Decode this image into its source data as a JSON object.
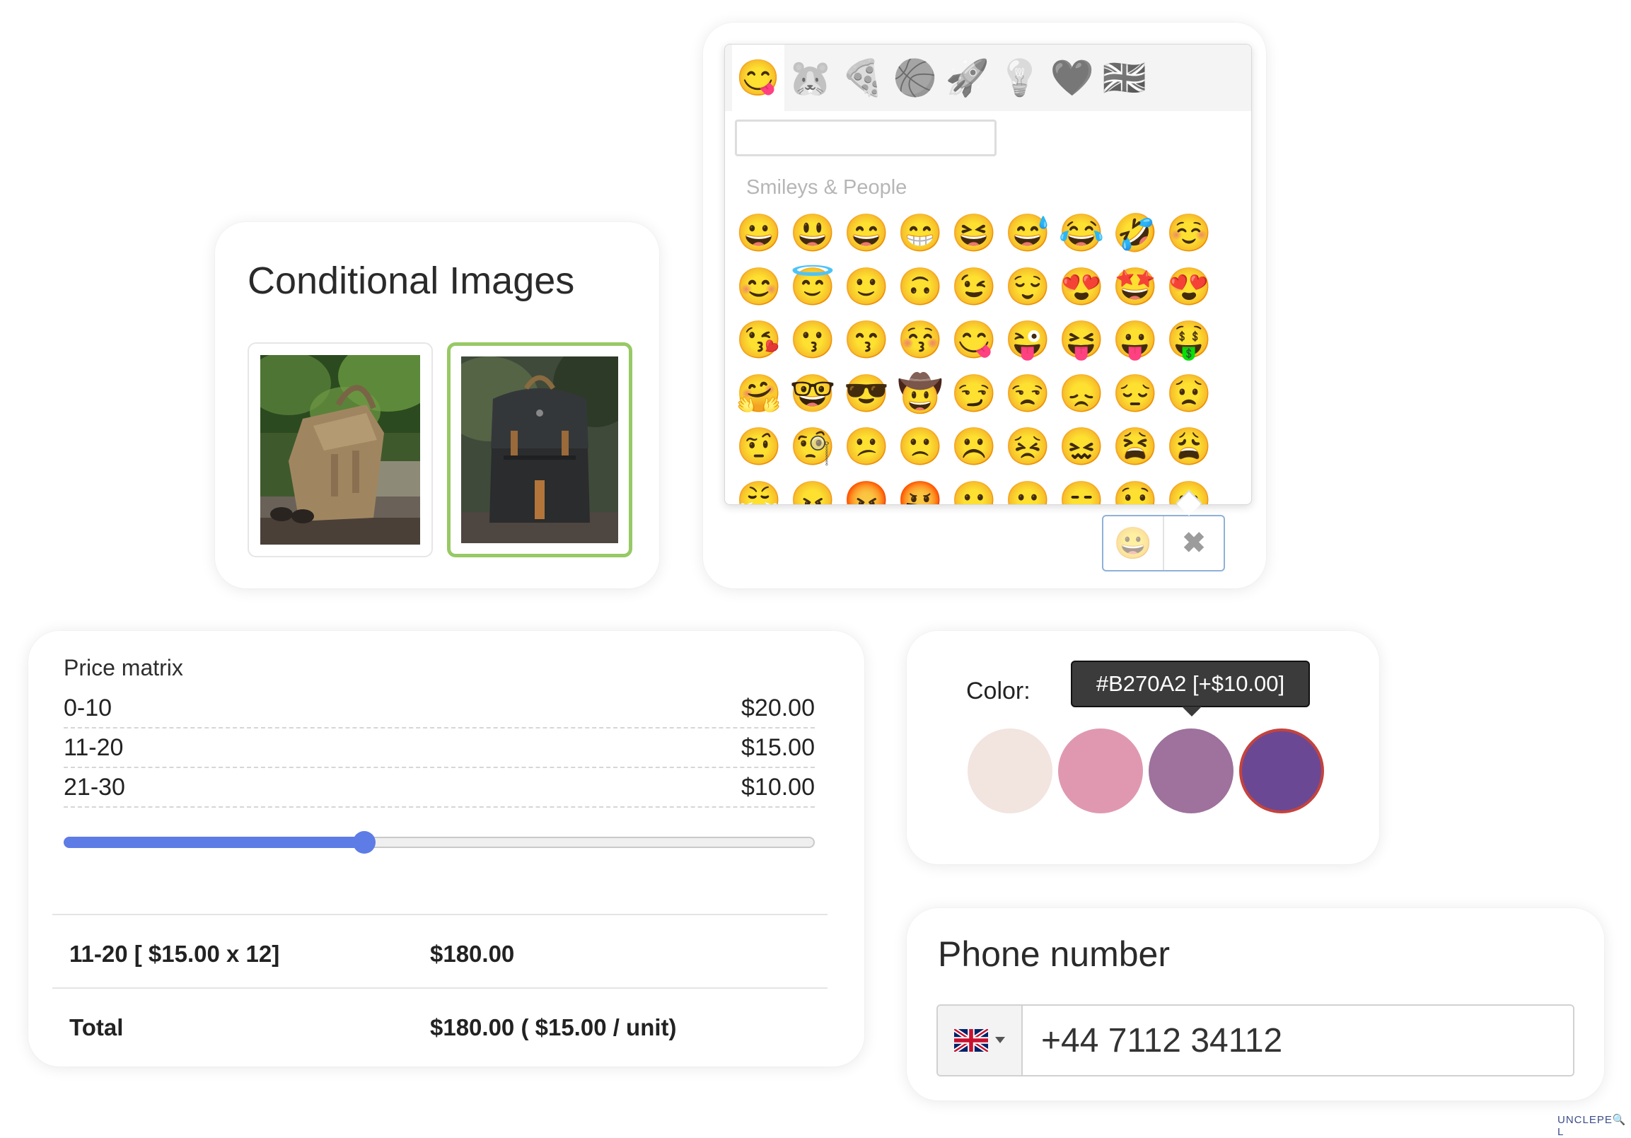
{
  "conditional_images": {
    "title": "Conditional Images",
    "options": [
      {
        "alt": "tan canvas backpack",
        "selected": false
      },
      {
        "alt": "black backpack",
        "selected": true
      }
    ],
    "selected_border_color": "#97c965"
  },
  "emoji_picker": {
    "category_tabs": [
      {
        "icon": "smiley-face",
        "glyph": "😋",
        "active": true
      },
      {
        "icon": "hamster",
        "glyph": "🐹",
        "active": false
      },
      {
        "icon": "pizza",
        "glyph": "🍕",
        "active": false
      },
      {
        "icon": "basketball",
        "glyph": "🏀",
        "active": false
      },
      {
        "icon": "rocket",
        "glyph": "🚀",
        "active": false
      },
      {
        "icon": "lightbulb",
        "glyph": "💡",
        "active": false
      },
      {
        "icon": "heart",
        "glyph": "🖤",
        "active": false
      },
      {
        "icon": "union-jack-flag",
        "glyph": "🇬🇧",
        "active": false
      }
    ],
    "search_value": "",
    "category_label": "Smileys & People",
    "emojis": [
      "😀",
      "😃",
      "😄",
      "😁",
      "😆",
      "😅",
      "😂",
      "🤣",
      "☺️",
      "😊",
      "😇",
      "🙂",
      "🙃",
      "😉",
      "😌",
      "😍",
      "🤩",
      "😍",
      "😘",
      "😗",
      "😙",
      "😚",
      "😋",
      "😜",
      "😝",
      "😛",
      "🤑",
      "🤗",
      "🤓",
      "😎",
      "🤠",
      "😏",
      "😒",
      "😞",
      "😔",
      "😟",
      "🤨",
      "🧐",
      "😕",
      "🙁",
      "☹️",
      "😣",
      "😖",
      "😫",
      "😩",
      "😤",
      "😠",
      "😡",
      "🤬",
      "😶",
      "😐",
      "😑",
      "😯",
      "😦"
    ],
    "trigger": {
      "icon": "grinning-face",
      "glyph": "😀",
      "clear_icon": "close-x",
      "clear_glyph": "✖"
    }
  },
  "price_matrix": {
    "title": "Price matrix",
    "rows": [
      {
        "range": "0-10",
        "price": "$20.00"
      },
      {
        "range": "11-20",
        "price": "$15.00"
      },
      {
        "range": "21-30",
        "price": "$10.00"
      }
    ],
    "slider_fraction": 0.4,
    "accent_color": "#5e7ce6",
    "summary": {
      "line_label": "11-20 [ $15.00 x 12]",
      "line_value": "$180.00",
      "total_label": "Total",
      "total_value": "$180.00 ( $15.00 / unit)"
    }
  },
  "color_picker": {
    "label": "Color:",
    "tooltip": "#B270A2 [+$10.00]",
    "swatches": [
      {
        "color": "#f2e4df",
        "selected": false
      },
      {
        "color": "#e098b0",
        "selected": false
      },
      {
        "color": "#9e729c",
        "selected": false
      },
      {
        "color": "#6b4894",
        "selected": true
      }
    ]
  },
  "phone": {
    "title": "Phone number",
    "country_flag": "union-jack-flag",
    "value": "+44 7112 34112"
  },
  "watermark": "UNCLEPE🔍L"
}
